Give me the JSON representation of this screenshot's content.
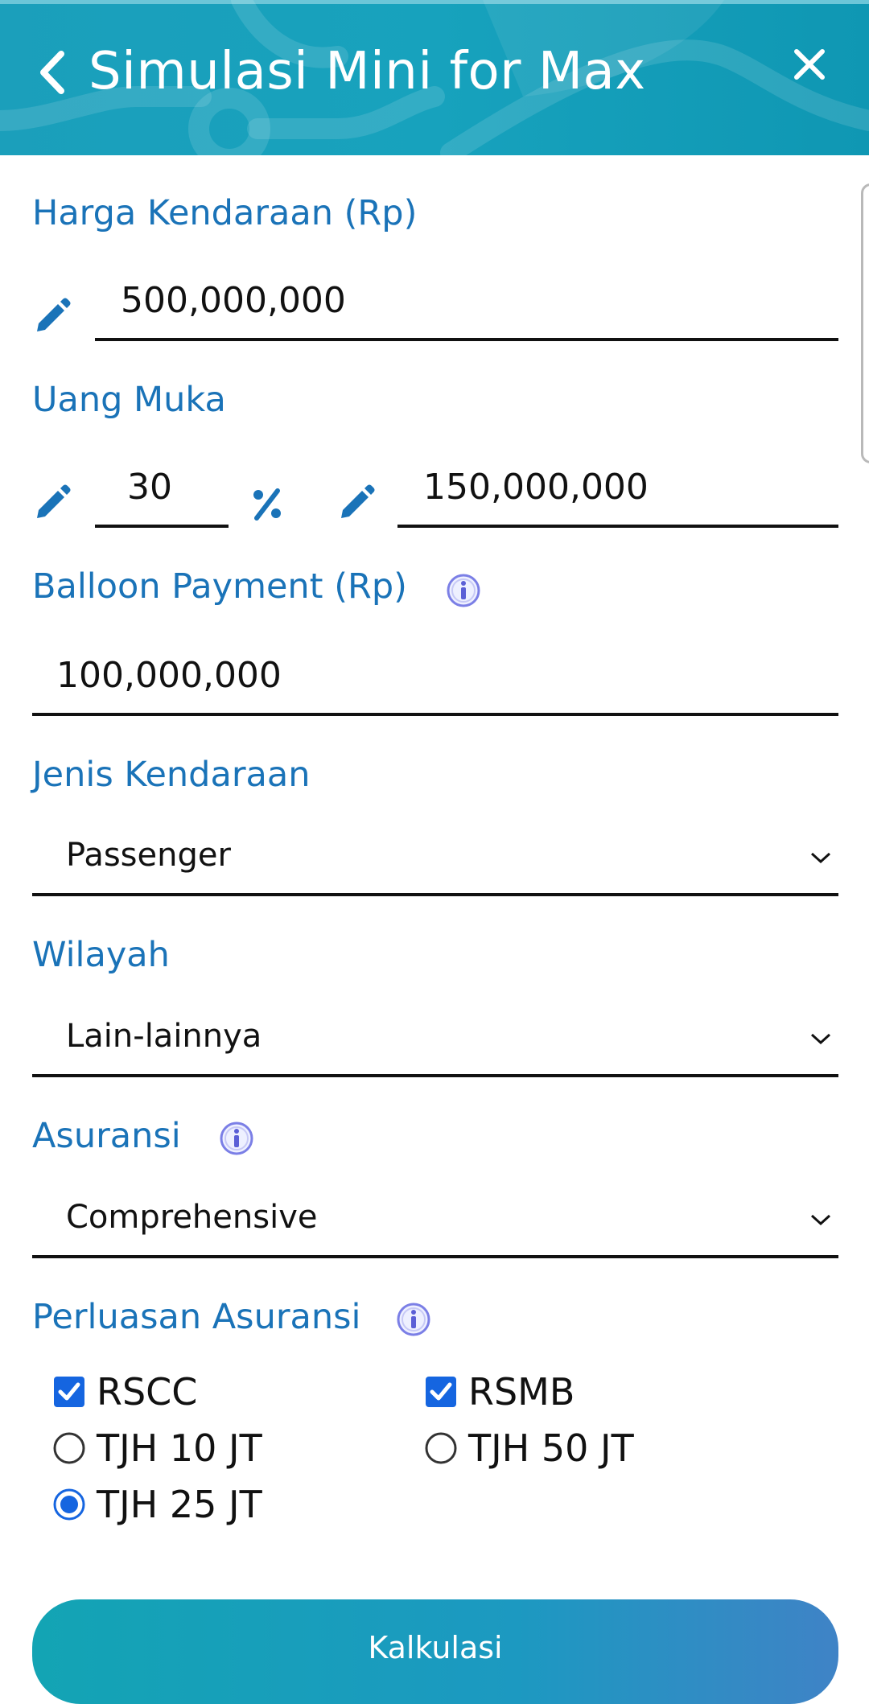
{
  "header": {
    "title": "Simulasi Mini for Max",
    "back_icon": "chevron-left-icon",
    "close_icon": "close-icon"
  },
  "colors": {
    "accent": "#1a73b8",
    "header_bg": "#17a2bd",
    "checkbox": "#1565e0",
    "info_icon": "#7b7fe6"
  },
  "fields": {
    "harga": {
      "label": "Harga Kendaraan (Rp)",
      "value": "500,000,000"
    },
    "uang_muka": {
      "label": "Uang Muka",
      "percent": "30",
      "amount": "150,000,000"
    },
    "balloon": {
      "label": "Balloon Payment (Rp)",
      "value": "100,000,000"
    },
    "jenis": {
      "label": "Jenis Kendaraan",
      "value": "Passenger"
    },
    "wilayah": {
      "label": "Wilayah",
      "value": "Lain-lainnya"
    },
    "asuransi": {
      "label": "Asuransi",
      "value": "Comprehensive"
    },
    "perluasan": {
      "label": "Perluasan Asuransi",
      "options": [
        {
          "label": "RSCC",
          "type": "checkbox",
          "checked": true
        },
        {
          "label": "RSMB",
          "type": "checkbox",
          "checked": true
        },
        {
          "label": "TJH 10 JT",
          "type": "radio",
          "checked": false
        },
        {
          "label": "TJH 50 JT",
          "type": "radio",
          "checked": false
        },
        {
          "label": "TJH 25 JT",
          "type": "radio",
          "checked": true
        }
      ]
    }
  },
  "actions": {
    "calculate_label": "Kalkulasi"
  }
}
